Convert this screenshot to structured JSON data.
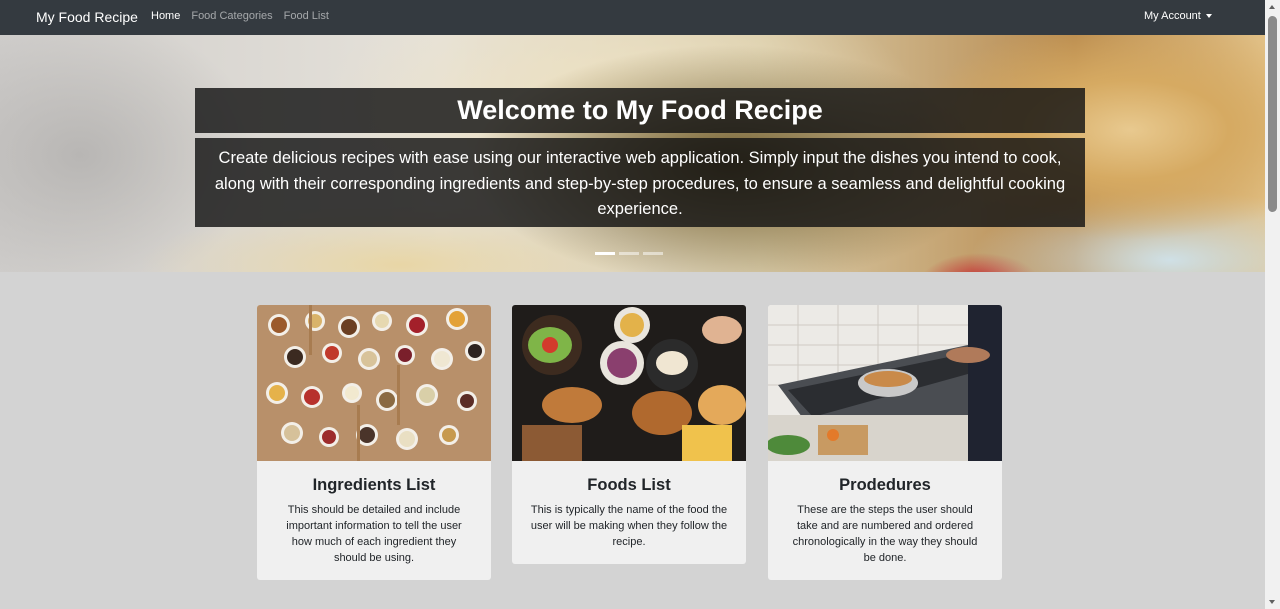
{
  "navbar": {
    "brand": "My Food Recipe",
    "links": [
      {
        "label": "Home",
        "active": true
      },
      {
        "label": "Food Categories",
        "active": false
      },
      {
        "label": "Food List",
        "active": false
      }
    ],
    "account_label": "My Account",
    "account_icon": "caret-down-icon"
  },
  "hero": {
    "title": "Welcome to My Food Recipe",
    "text": "Create delicious recipes with ease using our interactive web application. Simply input the dishes you intend to cook, along with their corresponding ingredients and step-by-step procedures, to ensure a seamless and delightful cooking experience.",
    "slides": 3,
    "active_slide": 1
  },
  "cards": [
    {
      "title": "Ingredients List",
      "text": "This should be detailed and include important information to tell the user how much of each ingredient they should be using.",
      "image": "spices-in-bowls-and-spoons"
    },
    {
      "title": "Foods List",
      "text": "This is typically the name of the food the user will be making when they follow the recipe.",
      "image": "table-of-assorted-dishes"
    },
    {
      "title": "Prodedures",
      "text": "These are the steps the user should take and are numbered and ordered chronologically in the way they should be done.",
      "image": "cooking-on-stove"
    }
  ],
  "colors": {
    "navbar_bg": "#343a40",
    "page_bg": "#d3d3d3",
    "card_bg": "#f0f0f0",
    "caption_bg": "#141414"
  }
}
